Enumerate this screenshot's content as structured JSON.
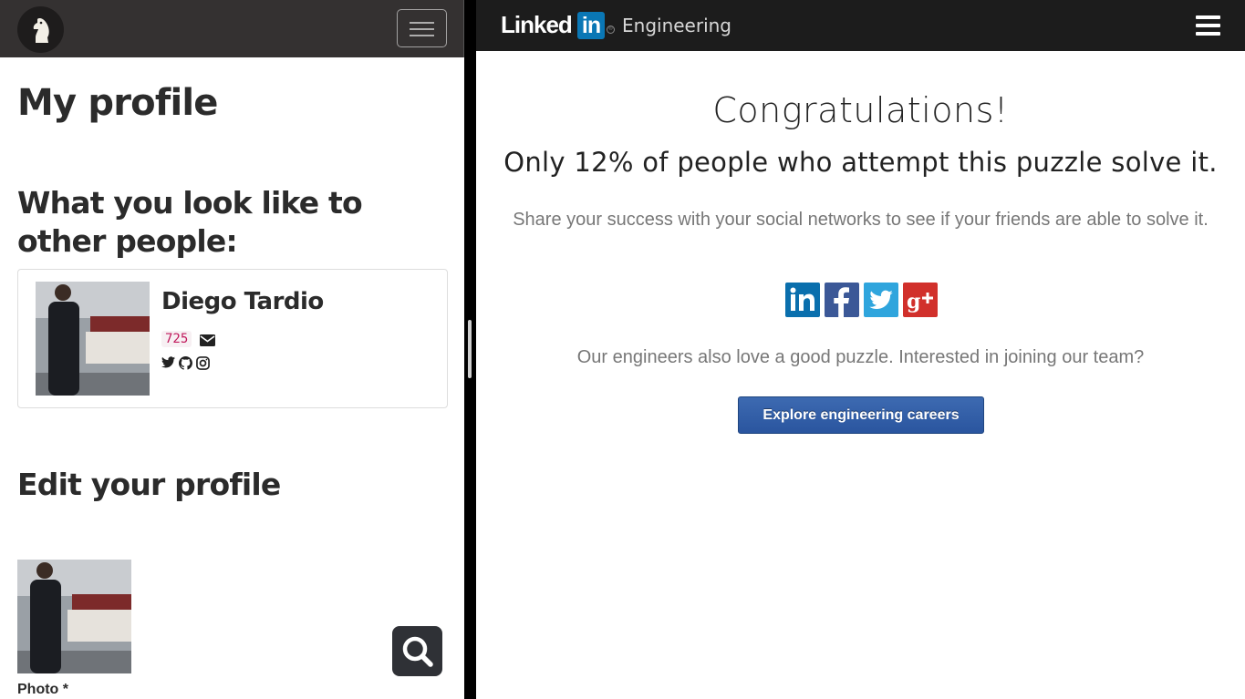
{
  "left": {
    "title": "My profile",
    "preview_heading": "What you look like to other people:",
    "profile": {
      "name": "Diego Tardio",
      "score": "725"
    },
    "edit_heading": "Edit your profile",
    "photo_label": "Photo *"
  },
  "right": {
    "brand": {
      "word": "Linked",
      "in": "in",
      "registered": "®",
      "section": "Engineering"
    },
    "heading": "Congratulations!",
    "subheading": "Only 12% of people who attempt this puzzle solve it.",
    "share_text": "Share your success with your social networks to see if your friends are able to solve it.",
    "social": [
      {
        "name": "linkedin",
        "color": "#0a6fad"
      },
      {
        "name": "facebook",
        "color": "#3b5897"
      },
      {
        "name": "twitter",
        "color": "#2fa5dd"
      },
      {
        "name": "google-plus",
        "color": "#d1302b"
      }
    ],
    "engineers_text": "Our engineers also love a good puzzle. Interested in joining our team?",
    "cta_label": "Explore engineering careers"
  },
  "colors": {
    "left_nav": "#343131",
    "right_nav": "#1c1c1c",
    "linkedin_blue": "#0a77b5",
    "cta": "#2a559f",
    "score_text": "#c0185b"
  }
}
